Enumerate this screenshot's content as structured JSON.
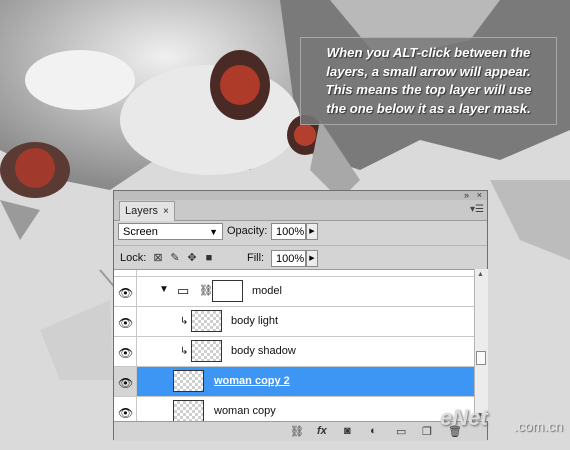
{
  "tooltip": {
    "lines": [
      "When you ALT-click between the",
      "layers, a small arrow will appear.",
      "This means the top layer will use",
      "the one below it as a layer mask."
    ]
  },
  "panel": {
    "tab_label": "Layers",
    "tab_close": "×",
    "blend_mode": "Screen",
    "opacity_label": "Opacity:",
    "opacity_value": "100%",
    "lock_label": "Lock:",
    "fill_label": "Fill:",
    "fill_value": "100%",
    "layers": [
      {
        "name": "model",
        "kind": "group"
      },
      {
        "name": "body light",
        "kind": "clipped"
      },
      {
        "name": "body shadow",
        "kind": "clipped"
      },
      {
        "name": "woman copy 2",
        "kind": "layer",
        "selected": true
      },
      {
        "name": "woman copy",
        "kind": "layer"
      }
    ],
    "footer_icons": [
      "link-icon",
      "fx-icon",
      "mask-icon",
      "adjustment-icon",
      "group-icon",
      "new-layer-icon",
      "trash-icon"
    ]
  },
  "watermark": {
    "brand": "eNet",
    "domain": ".com.cn"
  },
  "colors": {
    "selection": "#3d95f4",
    "panel": "#d4d4d4"
  }
}
